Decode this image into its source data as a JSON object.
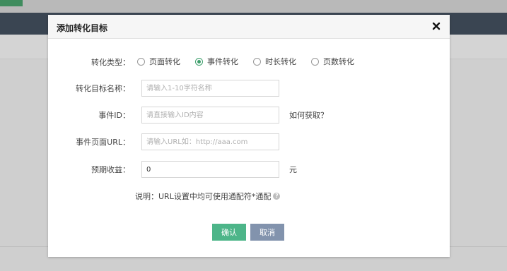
{
  "modal": {
    "title": "添加转化目标",
    "close_icon": "close-icon"
  },
  "form": {
    "type_label": "转化类型：",
    "type_options": [
      {
        "label": "页面转化",
        "checked": false
      },
      {
        "label": "事件转化",
        "checked": true
      },
      {
        "label": "时长转化",
        "checked": false
      },
      {
        "label": "页数转化",
        "checked": false
      }
    ],
    "name_label": "转化目标名称：",
    "name_placeholder": "请输入1-10字符名称",
    "name_value": "",
    "event_id_label": "事件ID：",
    "event_id_placeholder": "请直接输入ID内容",
    "event_id_value": "",
    "event_id_help": "如何获取？",
    "event_url_label": "事件页面URL：",
    "event_url_placeholder": "请输入URL如：http://aaa.com",
    "event_url_value": "",
    "revenue_label": "预期收益：",
    "revenue_value": "0",
    "revenue_unit": "元"
  },
  "note": {
    "text": "说明：URL设置中均可使用通配符*通配",
    "icon": "question-icon"
  },
  "buttons": {
    "ok": "确认",
    "cancel": "取消"
  },
  "colors": {
    "accent": "#3d9e6b",
    "ok_button": "#4db589",
    "cancel_button": "#8293ad",
    "header_bar": "#3a4552"
  }
}
